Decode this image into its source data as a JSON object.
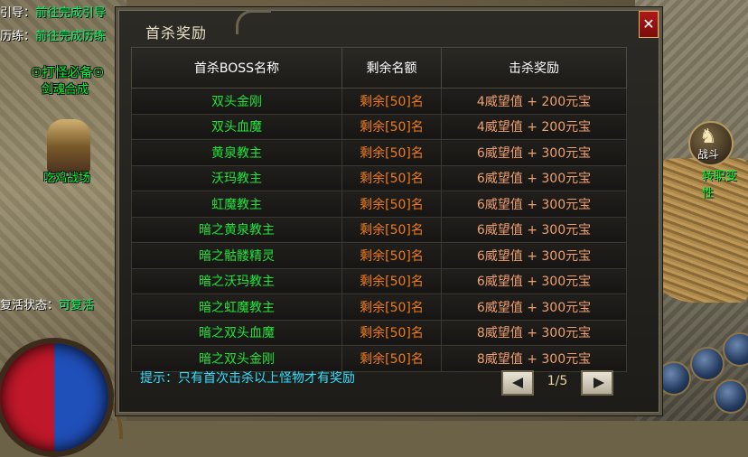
{
  "hud": {
    "guide_key": "引导：",
    "guide_value": "前往完成引导",
    "training_key": "历练：",
    "training_value": "前往完成历练",
    "revive_key": "复活状态：",
    "revive_value": "可复活"
  },
  "world": {
    "npc_top_line1": "☉打怪必备☉",
    "npc_top_line2": "剑魂合成",
    "npc_name": "吃鸡战场",
    "battle_label": "战斗",
    "jobs_label": "转职变性"
  },
  "dialog": {
    "title": "首杀奖励",
    "close_label": "✕",
    "columns": [
      "首杀BOSS名称",
      "剩余名额",
      "击杀奖励"
    ],
    "rows": [
      {
        "name": "双头金刚",
        "remain": "剩余[50]名",
        "reward": "4威望值 + 200元宝"
      },
      {
        "name": "双头血魔",
        "remain": "剩余[50]名",
        "reward": "4威望值 + 200元宝"
      },
      {
        "name": "黄泉教主",
        "remain": "剩余[50]名",
        "reward": "6威望值 + 300元宝"
      },
      {
        "name": "沃玛教主",
        "remain": "剩余[50]名",
        "reward": "6威望值 + 300元宝"
      },
      {
        "name": "虹魔教主",
        "remain": "剩余[50]名",
        "reward": "6威望值 + 300元宝"
      },
      {
        "name": "暗之黄泉教主",
        "remain": "剩余[50]名",
        "reward": "6威望值 + 300元宝"
      },
      {
        "name": "暗之骷髅精灵",
        "remain": "剩余[50]名",
        "reward": "6威望值 + 300元宝"
      },
      {
        "name": "暗之沃玛教主",
        "remain": "剩余[50]名",
        "reward": "6威望值 + 300元宝"
      },
      {
        "name": "暗之虹魔教主",
        "remain": "剩余[50]名",
        "reward": "6威望值 + 300元宝"
      },
      {
        "name": "暗之双头血魔",
        "remain": "剩余[50]名",
        "reward": "8威望值 + 300元宝"
      },
      {
        "name": "暗之双头金刚",
        "remain": "剩余[50]名",
        "reward": "8威望值 + 300元宝"
      }
    ],
    "hint": "提示：只有首次击杀以上怪物才有奖励",
    "pager": "1/5"
  },
  "colors": {
    "boss_name": "#22e33a",
    "remain": "#f07c1a",
    "reward": "#f0a070",
    "hint": "#2fe0ff"
  }
}
